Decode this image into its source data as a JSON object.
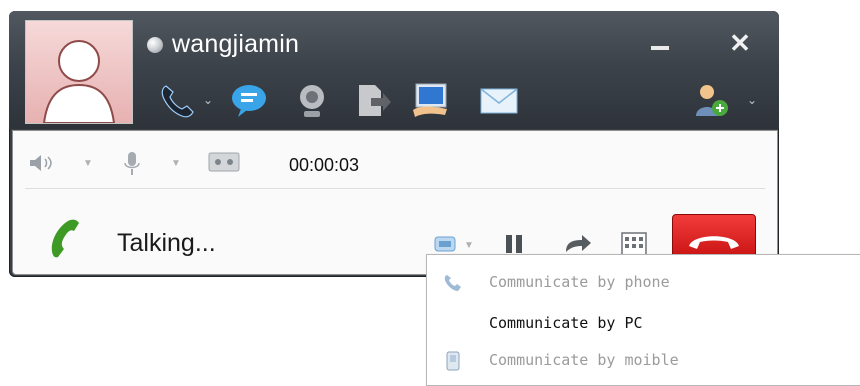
{
  "contact": {
    "name": "wangjiamin",
    "presence": "offline"
  },
  "window_controls": {
    "minimize_icon": "minimize-icon",
    "close_glyph": "✕"
  },
  "toolbar": {
    "icons": [
      "phone-icon",
      "chevron-down-icon",
      "chat-icon",
      "webcam-icon",
      "file-transfer-icon",
      "screen-share-icon",
      "mail-icon",
      "add-contact-icon",
      "chevron-down-icon"
    ]
  },
  "call_controls": {
    "timer": "00:00:03",
    "status": "Talking...",
    "colors": {
      "hangup": "#d61b1b",
      "talking": "#3d9b25"
    }
  },
  "route_menu": {
    "items": [
      {
        "label": "Communicate by phone",
        "enabled": false,
        "icon": "phone-icon"
      },
      {
        "label": "Communicate by PC",
        "enabled": true,
        "icon": ""
      },
      {
        "label": "Communicate by moible",
        "enabled": false,
        "icon": "mobile-icon"
      }
    ]
  }
}
